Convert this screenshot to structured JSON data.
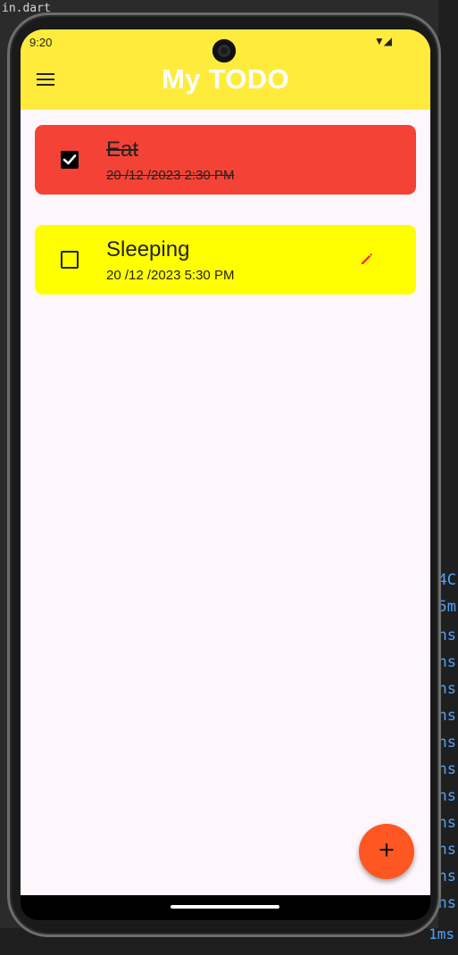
{
  "background": {
    "file_tab": "in.dart",
    "right_glyphs": [
      "4C",
      "5m",
      "ns",
      "ns",
      "ns",
      "ns",
      "ns",
      "ns",
      "ns",
      "ns",
      "ns",
      "ns",
      "ns",
      "ns"
    ],
    "bottom_text": "1ms"
  },
  "status": {
    "time": "9:20",
    "icons": "▼◢"
  },
  "app": {
    "title": "My TODO",
    "accent": "#ffeb3b"
  },
  "tasks": [
    {
      "title": "Eat",
      "datetime": "20 /12 /2023 2:30 PM",
      "done": true,
      "color": "#f44336"
    },
    {
      "title": "Sleeping",
      "datetime": "20 /12 /2023 5:30 PM",
      "done": false,
      "color": "#ffff00"
    }
  ],
  "fab": {
    "label": "+",
    "color": "#ff5722"
  },
  "icons": {
    "menu": "hamburger-menu-icon",
    "edit": "pencil-icon",
    "check": "checkmark-icon"
  }
}
